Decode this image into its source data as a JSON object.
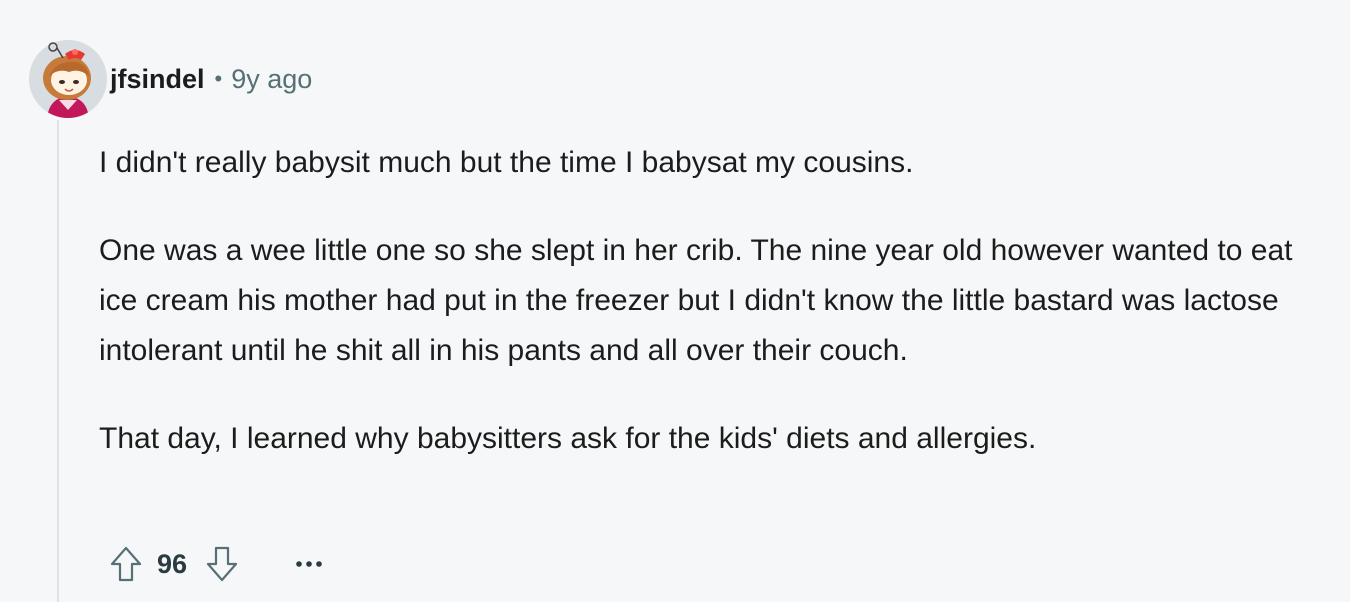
{
  "comment": {
    "author": "jfsindel",
    "separator": "•",
    "timestamp": "9y ago",
    "avatar_icon": "snoo-avatar-icon",
    "paragraphs": [
      "I didn't really babysit much but the time I babysat my cousins.",
      "One was a wee little one so she slept in her crib. The nine year old however wanted to eat ice cream his mother had put in the freezer but I didn't know the little bastard was lactose intolerant until he shit all in his pants and all over their couch.",
      "That day, I learned why babysitters ask for the kids' diets and allergies."
    ],
    "actions": {
      "upvote_icon": "upvote-arrow-icon",
      "score": "96",
      "downvote_icon": "downvote-arrow-icon",
      "more_icon": "ellipsis-icon"
    }
  },
  "colors": {
    "background": "#f6f7f8",
    "text": "#1c1c1c",
    "meta": "#576f76",
    "thread_line": "#dfe3e6"
  }
}
